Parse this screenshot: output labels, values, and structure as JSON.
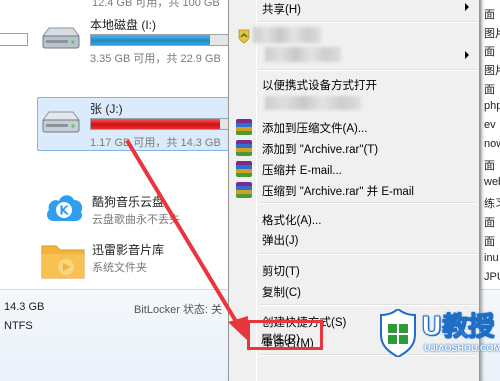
{
  "explorer": {
    "top_strip_text": "12.4 GB 可用，共 100 GB",
    "drive_i": {
      "name": "本地磁盘 (I:)",
      "size": "3.35 GB 可用，共 22.9 GB",
      "used_fraction": 0.85,
      "bar_color": "#1d8bc9"
    },
    "drive_j": {
      "name": "张 (J:)",
      "size": "1.17 GB 可用，共 14.3 GB",
      "used_fraction": 0.92,
      "bar_color": "#d11010"
    },
    "app_kugou": {
      "name": "酷狗音乐云盘",
      "sub": "云盘歌曲永不丢失"
    },
    "app_xunlei": {
      "name": "迅雷影音片库",
      "sub": "系统文件夹"
    },
    "details": {
      "size": "14.3 GB",
      "fs": "NTFS",
      "bitlocker": "BitLocker 状态: 关"
    },
    "right_col": [
      "面",
      "图片",
      "面",
      "图片",
      "面",
      "php",
      "ev",
      "now",
      "面",
      "web",
      "练习",
      "面",
      "面",
      "inu",
      "JPU"
    ]
  },
  "menu": {
    "share": "共享(H)",
    "portable_open": "以便携式设备方式打开",
    "add_archive": "添加到压缩文件(A)...",
    "add_rar": "添加到 \"Archive.rar\"(T)",
    "compress_email": "压缩并 E-mail...",
    "compress_rar_email": "压缩到 \"Archive.rar\" 并 E-mail",
    "format": "格式化(A)...",
    "eject": "弹出(J)",
    "cut": "剪切(T)",
    "copy": "复制(C)",
    "create_shortcut": "创建快捷方式(S)",
    "rename": "重命名(M)",
    "properties": "属性(R)"
  },
  "logo": {
    "brand": "U教授",
    "site": "UJIAOSHOU.COM"
  },
  "colors": {
    "menu_bg": "#f0f0f0",
    "highlight": "#e8353e",
    "selection": "#dcebfc",
    "brand": "#1e6ec8"
  }
}
